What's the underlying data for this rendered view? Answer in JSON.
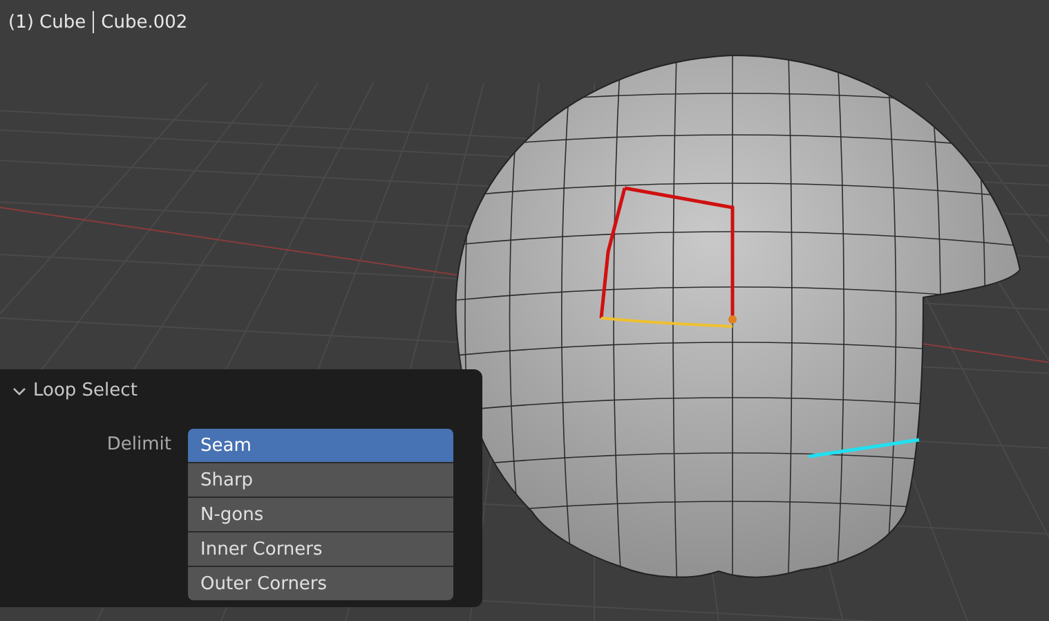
{
  "viewport": {
    "object_name": "(1) Cube",
    "mesh_name": "Cube.002"
  },
  "operator_panel": {
    "title": "Loop Select",
    "expanded": true,
    "field_label": "Delimit",
    "options": [
      {
        "label": "Seam",
        "selected": true
      },
      {
        "label": "Sharp",
        "selected": false
      },
      {
        "label": "N-gons",
        "selected": false
      },
      {
        "label": "Inner Corners",
        "selected": false
      },
      {
        "label": "Outer Corners",
        "selected": false
      }
    ]
  }
}
